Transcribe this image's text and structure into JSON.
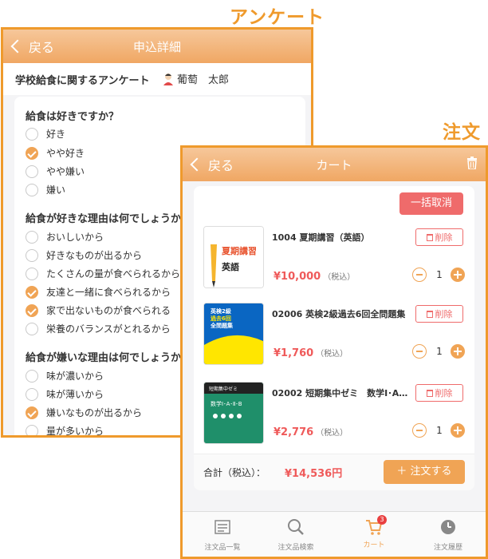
{
  "labels": {
    "survey_callout": "アンケート",
    "order_callout": "注文"
  },
  "survey_screen": {
    "nav": {
      "back_label": "戻る",
      "title": "申込詳細"
    },
    "survey_title": "学校給食に関するアンケート",
    "user_name": "葡萄　太郎",
    "questions": [
      {
        "text": "給食は好きですか？",
        "options": [
          {
            "label": "好き",
            "selected": false
          },
          {
            "label": "やや好き",
            "selected": true
          },
          {
            "label": "やや嫌い",
            "selected": false
          },
          {
            "label": "嫌い",
            "selected": false
          }
        ]
      },
      {
        "text": "給食が好きな理由は何でしょうか",
        "options": [
          {
            "label": "おいしいから",
            "selected": false
          },
          {
            "label": "好きなものが出るから",
            "selected": false
          },
          {
            "label": "たくさんの量が食べられるから",
            "selected": false
          },
          {
            "label": "友達と一緒に食べられるから",
            "selected": true
          },
          {
            "label": "家で出ないものが食べられる",
            "selected": true
          },
          {
            "label": "栄養のバランスがとれるから",
            "selected": false
          }
        ]
      },
      {
        "text": "給食が嫌いな理由は何でしょうか",
        "options": [
          {
            "label": "味が濃いから",
            "selected": false
          },
          {
            "label": "味が薄いから",
            "selected": false
          },
          {
            "label": "嫌いなものが出るから",
            "selected": true
          },
          {
            "label": "量が多いから",
            "selected": false
          }
        ]
      }
    ]
  },
  "cart_screen": {
    "nav": {
      "back_label": "戻る",
      "title": "カート"
    },
    "bulk_cancel_label": "一括取消",
    "delete_label": "削除",
    "tax_label": "（税込）",
    "items": [
      {
        "name": "1004 夏期講習（英語）",
        "price": "¥10,000",
        "qty": "1",
        "cover": {
          "line1": "夏期講習",
          "line2": "英語"
        }
      },
      {
        "name": "02006 英検2級過去6回全問題集",
        "price": "¥1,760",
        "qty": "1",
        "cover": {
          "line1": "英検2級",
          "line2": "過去6回",
          "line3": "全問題集"
        }
      },
      {
        "name": "02002 短期集中ゼミ　数学Ⅰ･A･...",
        "price": "¥2,776",
        "qty": "1",
        "cover": {
          "line1": "短期集中ゼミ",
          "line2": "数学Ⅰ･A･Ⅱ･B"
        }
      }
    ],
    "total_label": "合計（税込）：",
    "total_value": "¥14,536円",
    "order_button_label": "＋ 注文する",
    "tabs": [
      {
        "label": "注文品一覧",
        "icon": "list-icon",
        "active": false
      },
      {
        "label": "注文品検索",
        "icon": "search-icon",
        "active": false
      },
      {
        "label": "カート",
        "icon": "cart-icon",
        "active": true,
        "badge": "3"
      },
      {
        "label": "注文履歴",
        "icon": "clock-icon",
        "active": false
      }
    ]
  }
}
